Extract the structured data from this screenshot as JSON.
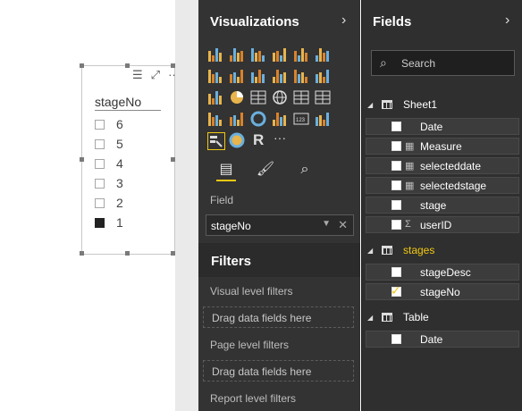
{
  "slicer": {
    "title": "stageNo",
    "items": [
      {
        "label": "6",
        "checked": false
      },
      {
        "label": "5",
        "checked": false
      },
      {
        "label": "4",
        "checked": false
      },
      {
        "label": "3",
        "checked": false
      },
      {
        "label": "2",
        "checked": false
      },
      {
        "label": "1",
        "checked": true
      }
    ],
    "more_label": "···"
  },
  "visualizations": {
    "title": "Visualizations",
    "chevron": "›",
    "more_label": "···",
    "r_label": "R",
    "field_label": "Field",
    "field_value": "stageNo",
    "field_remove": "✕"
  },
  "filters": {
    "title": "Filters",
    "visual_level": "Visual level filters",
    "visual_drop": "Drag data fields here",
    "page_level": "Page level filters",
    "page_drop": "Drag data fields here",
    "report_level": "Report level filters"
  },
  "fields_pane": {
    "title": "Fields",
    "chevron": "›",
    "search_placeholder": "Search",
    "tables": [
      {
        "name": "Sheet1",
        "highlight": false,
        "fields": [
          {
            "name": "Date",
            "icon": "",
            "checked": false
          },
          {
            "name": "Measure",
            "icon": "▦",
            "checked": false
          },
          {
            "name": "selecteddate",
            "icon": "▦",
            "checked": false
          },
          {
            "name": "selectedstage",
            "icon": "▦",
            "checked": false
          },
          {
            "name": "stage",
            "icon": "",
            "checked": false
          },
          {
            "name": "userID",
            "icon": "Σ",
            "checked": false
          }
        ]
      },
      {
        "name": "stages",
        "highlight": true,
        "fields": [
          {
            "name": "stageDesc",
            "icon": "",
            "checked": false
          },
          {
            "name": "stageNo",
            "icon": "",
            "checked": true
          }
        ]
      },
      {
        "name": "Table",
        "highlight": false,
        "fields": [
          {
            "name": "Date",
            "icon": "",
            "checked": false
          }
        ]
      }
    ]
  },
  "colors": {
    "accent_yellow": "#f2c811",
    "pane_dark": "#333333"
  }
}
